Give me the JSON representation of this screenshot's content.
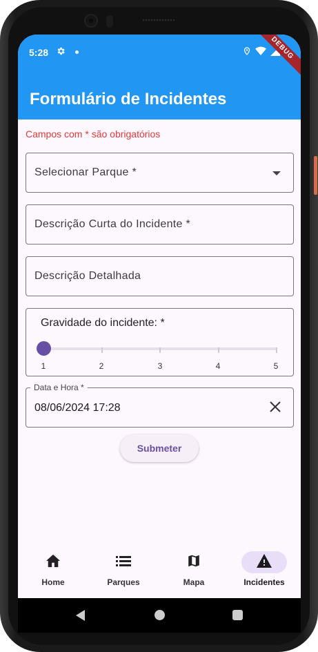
{
  "status_bar": {
    "time": "5:28"
  },
  "debug_banner": "DEBUG",
  "app_bar": {
    "title": "Formulário de Incidentes"
  },
  "form": {
    "required_note": "Campos com * são obrigatórios",
    "park_select": {
      "label": "Selecionar Parque *"
    },
    "short_description": {
      "label": "Descrição Curta do Incidente *"
    },
    "detailed_description": {
      "label": "Descrição Detalhada"
    },
    "severity": {
      "title": "Gravidade do incidente: *",
      "value": 1,
      "min": 1,
      "max": 5,
      "ticks": [
        "1",
        "2",
        "3",
        "4",
        "5"
      ]
    },
    "datetime": {
      "label": "Data e Hora *",
      "value": "08/06/2024 17:28"
    },
    "submit_label": "Submeter"
  },
  "bottom_nav": {
    "items": [
      {
        "label": "Home",
        "icon": "home-icon"
      },
      {
        "label": "Parques",
        "icon": "list-icon"
      },
      {
        "label": "Mapa",
        "icon": "map-icon"
      },
      {
        "label": "Incidentes",
        "icon": "warning-icon",
        "active": true
      }
    ]
  },
  "colors": {
    "app_bar": "#2196f3",
    "accent": "#6750a4",
    "error_text": "#e53935",
    "active_nav": "#e8def8"
  }
}
